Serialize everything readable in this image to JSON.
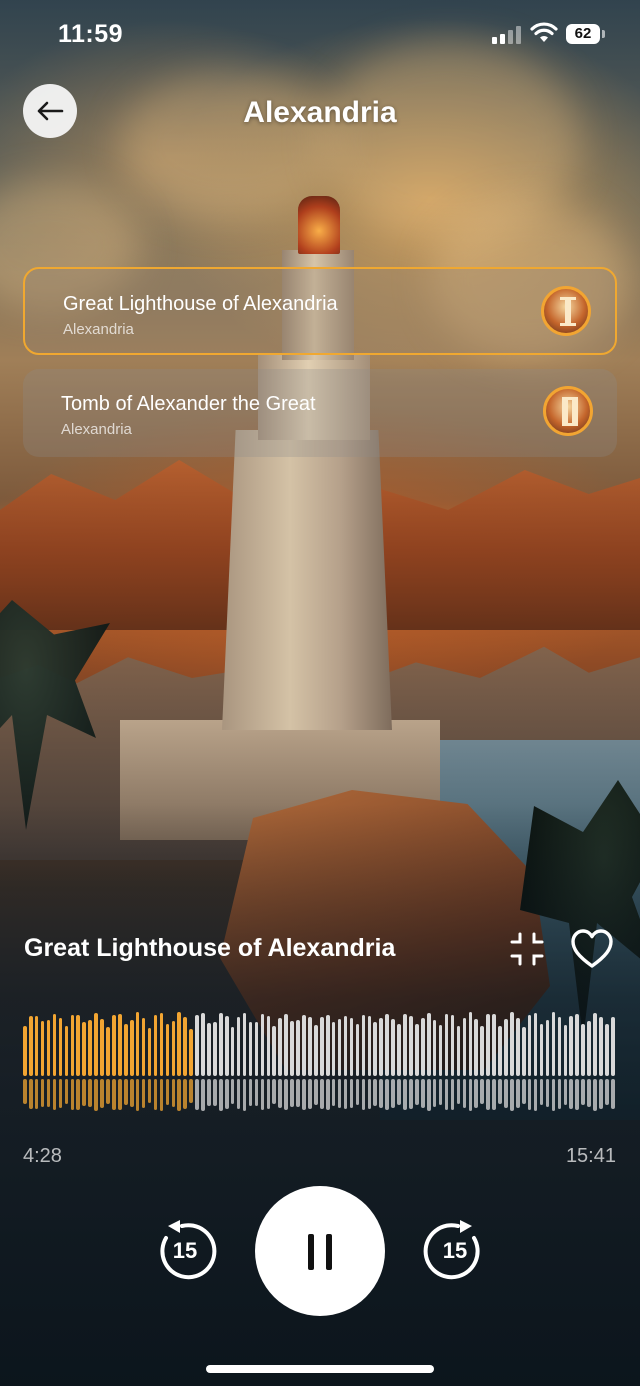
{
  "status_bar": {
    "time": "11:59",
    "battery": "62"
  },
  "header": {
    "title": "Alexandria",
    "back_icon": "arrow-left-icon"
  },
  "places": [
    {
      "title": "Great Lighthouse of Alexandria",
      "subtitle": "Alexandria",
      "active": true,
      "icon": "landmark-icon"
    },
    {
      "title": "Tomb of Alexander the Great",
      "subtitle": "Alexandria",
      "active": false,
      "icon": "landmark-icon"
    }
  ],
  "player": {
    "title": "Great Lighthouse of Alexandria",
    "elapsed": "4:28",
    "total": "15:41",
    "progress": 0.285,
    "rewind_label": "15",
    "forward_label": "15",
    "state": "playing"
  },
  "colors": {
    "accent": "#f2a532",
    "wave_played": "#f2a532",
    "wave_unplayed": "#d9d9d9"
  }
}
